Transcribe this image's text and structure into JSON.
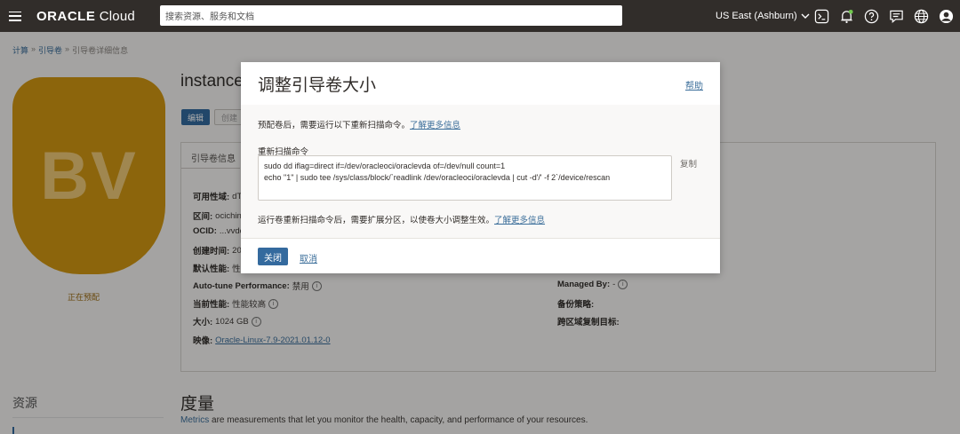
{
  "nav": {
    "logo_brand": "ORACLE",
    "logo_product": " Cloud",
    "search_placeholder": "搜索资源、服务和文档",
    "region": "US East (Ashburn)",
    "icons": [
      "menu-icon",
      "terminal-icon",
      "bell-icon",
      "help-icon",
      "chat-icon",
      "globe-icon",
      "user-icon"
    ]
  },
  "breadcrumb": [
    "计算",
    "»",
    "引导卷",
    "»",
    "引导卷详细信息"
  ],
  "page": {
    "title": "instance",
    "icon_text": "BV",
    "status": "正在预配",
    "edit_label": "编辑",
    "create_label": "创建",
    "tab_label": "引导卷信息",
    "fields_left": [
      {
        "label": "可用性域:",
        "value": "dT"
      },
      {
        "label": "区间:",
        "value": "ocichin"
      },
      {
        "label": "OCID:",
        "value": "...vvdc"
      },
      {
        "label": "创建时间:",
        "value": "20"
      },
      {
        "label": "默认性能:",
        "value": "性"
      },
      {
        "label": "Auto-tune Performance:",
        "value": "禁用"
      },
      {
        "label": "当前性能:",
        "value": "性能较高"
      },
      {
        "label": "大小:",
        "value": "1024 GB"
      },
      {
        "label": "映像:",
        "value": "Oracle-Linux-7.9-2021.01.12-0"
      }
    ],
    "fields_right": [
      {
        "label": "Managed By:",
        "value": "-"
      },
      {
        "label": "备份策略:",
        "value": ""
      },
      {
        "label": "跨区域复制目标:",
        "value": ""
      }
    ],
    "resources_label": "资源",
    "metrics_title": "度量",
    "metrics_link": "Metrics",
    "metrics_desc": " are measurements that let you monitor the health, capacity, and performance of your resources."
  },
  "modal": {
    "title": "调整引导卷大小",
    "help": "帮助",
    "desc1": "预配卷后，需要运行以下重新扫描命令。",
    "desc1_link": "了解更多信息",
    "cmd_label": "重新扫描命令",
    "cmd_line1": "sudo dd iflag=direct if=/dev/oracleoci/oraclevda of=/dev/null count=1",
    "cmd_line2": "echo \"1\" | sudo tee /sys/class/block/`readlink /dev/oracleoci/oraclevda | cut -d'/' -f 2`/device/rescan",
    "copy": "复制",
    "desc2": "运行卷重新扫描命令后，需要扩展分区，以使卷大小调整生效。",
    "desc2_link": "了解更多信息",
    "close": "关闭",
    "cancel": "取消"
  },
  "colors": {
    "topbar": "#312d2a",
    "primary": "#346a9e",
    "bv_icon": "#d19712"
  }
}
